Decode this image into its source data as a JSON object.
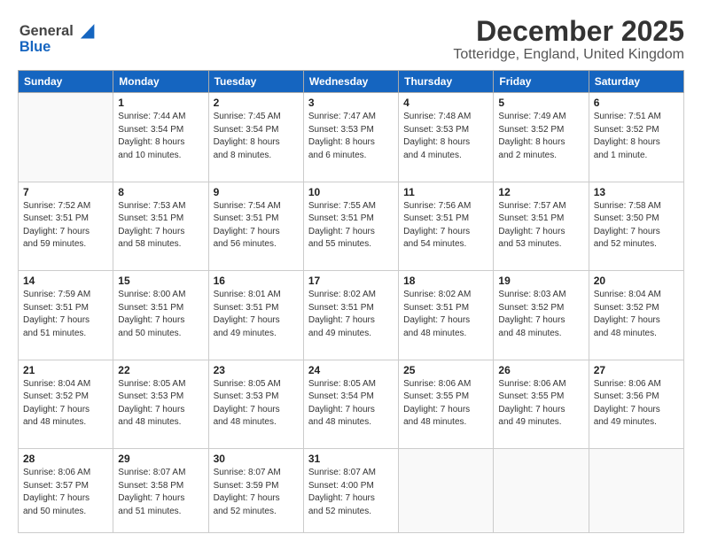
{
  "logo": {
    "line1": "General",
    "line2": "Blue"
  },
  "header": {
    "month": "December 2025",
    "location": "Totteridge, England, United Kingdom"
  },
  "weekdays": [
    "Sunday",
    "Monday",
    "Tuesday",
    "Wednesday",
    "Thursday",
    "Friday",
    "Saturday"
  ],
  "weeks": [
    [
      {
        "day": "",
        "detail": ""
      },
      {
        "day": "1",
        "detail": "Sunrise: 7:44 AM\nSunset: 3:54 PM\nDaylight: 8 hours\nand 10 minutes."
      },
      {
        "day": "2",
        "detail": "Sunrise: 7:45 AM\nSunset: 3:54 PM\nDaylight: 8 hours\nand 8 minutes."
      },
      {
        "day": "3",
        "detail": "Sunrise: 7:47 AM\nSunset: 3:53 PM\nDaylight: 8 hours\nand 6 minutes."
      },
      {
        "day": "4",
        "detail": "Sunrise: 7:48 AM\nSunset: 3:53 PM\nDaylight: 8 hours\nand 4 minutes."
      },
      {
        "day": "5",
        "detail": "Sunrise: 7:49 AM\nSunset: 3:52 PM\nDaylight: 8 hours\nand 2 minutes."
      },
      {
        "day": "6",
        "detail": "Sunrise: 7:51 AM\nSunset: 3:52 PM\nDaylight: 8 hours\nand 1 minute."
      }
    ],
    [
      {
        "day": "7",
        "detail": "Sunrise: 7:52 AM\nSunset: 3:51 PM\nDaylight: 7 hours\nand 59 minutes."
      },
      {
        "day": "8",
        "detail": "Sunrise: 7:53 AM\nSunset: 3:51 PM\nDaylight: 7 hours\nand 58 minutes."
      },
      {
        "day": "9",
        "detail": "Sunrise: 7:54 AM\nSunset: 3:51 PM\nDaylight: 7 hours\nand 56 minutes."
      },
      {
        "day": "10",
        "detail": "Sunrise: 7:55 AM\nSunset: 3:51 PM\nDaylight: 7 hours\nand 55 minutes."
      },
      {
        "day": "11",
        "detail": "Sunrise: 7:56 AM\nSunset: 3:51 PM\nDaylight: 7 hours\nand 54 minutes."
      },
      {
        "day": "12",
        "detail": "Sunrise: 7:57 AM\nSunset: 3:51 PM\nDaylight: 7 hours\nand 53 minutes."
      },
      {
        "day": "13",
        "detail": "Sunrise: 7:58 AM\nSunset: 3:50 PM\nDaylight: 7 hours\nand 52 minutes."
      }
    ],
    [
      {
        "day": "14",
        "detail": "Sunrise: 7:59 AM\nSunset: 3:51 PM\nDaylight: 7 hours\nand 51 minutes."
      },
      {
        "day": "15",
        "detail": "Sunrise: 8:00 AM\nSunset: 3:51 PM\nDaylight: 7 hours\nand 50 minutes."
      },
      {
        "day": "16",
        "detail": "Sunrise: 8:01 AM\nSunset: 3:51 PM\nDaylight: 7 hours\nand 49 minutes."
      },
      {
        "day": "17",
        "detail": "Sunrise: 8:02 AM\nSunset: 3:51 PM\nDaylight: 7 hours\nand 49 minutes."
      },
      {
        "day": "18",
        "detail": "Sunrise: 8:02 AM\nSunset: 3:51 PM\nDaylight: 7 hours\nand 48 minutes."
      },
      {
        "day": "19",
        "detail": "Sunrise: 8:03 AM\nSunset: 3:52 PM\nDaylight: 7 hours\nand 48 minutes."
      },
      {
        "day": "20",
        "detail": "Sunrise: 8:04 AM\nSunset: 3:52 PM\nDaylight: 7 hours\nand 48 minutes."
      }
    ],
    [
      {
        "day": "21",
        "detail": "Sunrise: 8:04 AM\nSunset: 3:52 PM\nDaylight: 7 hours\nand 48 minutes."
      },
      {
        "day": "22",
        "detail": "Sunrise: 8:05 AM\nSunset: 3:53 PM\nDaylight: 7 hours\nand 48 minutes."
      },
      {
        "day": "23",
        "detail": "Sunrise: 8:05 AM\nSunset: 3:53 PM\nDaylight: 7 hours\nand 48 minutes."
      },
      {
        "day": "24",
        "detail": "Sunrise: 8:05 AM\nSunset: 3:54 PM\nDaylight: 7 hours\nand 48 minutes."
      },
      {
        "day": "25",
        "detail": "Sunrise: 8:06 AM\nSunset: 3:55 PM\nDaylight: 7 hours\nand 48 minutes."
      },
      {
        "day": "26",
        "detail": "Sunrise: 8:06 AM\nSunset: 3:55 PM\nDaylight: 7 hours\nand 49 minutes."
      },
      {
        "day": "27",
        "detail": "Sunrise: 8:06 AM\nSunset: 3:56 PM\nDaylight: 7 hours\nand 49 minutes."
      }
    ],
    [
      {
        "day": "28",
        "detail": "Sunrise: 8:06 AM\nSunset: 3:57 PM\nDaylight: 7 hours\nand 50 minutes."
      },
      {
        "day": "29",
        "detail": "Sunrise: 8:07 AM\nSunset: 3:58 PM\nDaylight: 7 hours\nand 51 minutes."
      },
      {
        "day": "30",
        "detail": "Sunrise: 8:07 AM\nSunset: 3:59 PM\nDaylight: 7 hours\nand 52 minutes."
      },
      {
        "day": "31",
        "detail": "Sunrise: 8:07 AM\nSunset: 4:00 PM\nDaylight: 7 hours\nand 52 minutes."
      },
      {
        "day": "",
        "detail": ""
      },
      {
        "day": "",
        "detail": ""
      },
      {
        "day": "",
        "detail": ""
      }
    ]
  ]
}
